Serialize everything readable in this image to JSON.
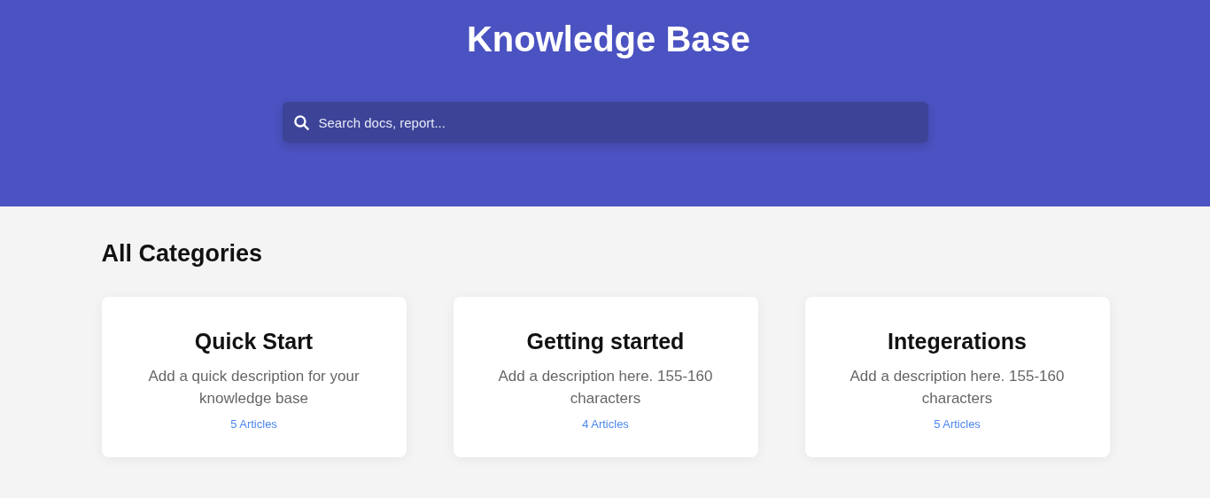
{
  "header": {
    "title": "Knowledge Base",
    "search": {
      "placeholder": "Search docs, report..."
    }
  },
  "section": {
    "title": "All Categories"
  },
  "categories": [
    {
      "title": "Quick Start",
      "description": "Add a quick description for your knowledge base",
      "articles": "5 Articles"
    },
    {
      "title": "Getting started",
      "description": "Add a description here. 155-160 characters",
      "articles": "4 Articles"
    },
    {
      "title": "Integerations",
      "description": "Add a description here. 155-160 characters",
      "articles": "5 Articles"
    }
  ]
}
